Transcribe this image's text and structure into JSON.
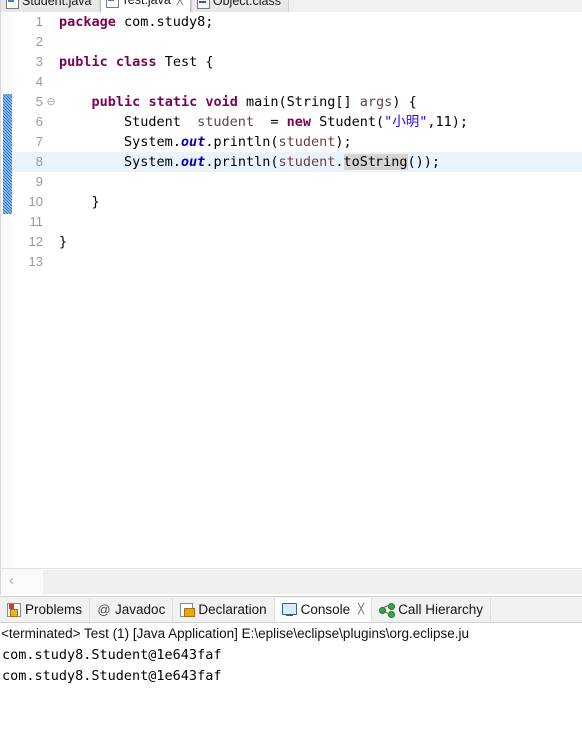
{
  "editor": {
    "tabs": [
      {
        "label": "Student.java",
        "icon": "java-file-icon",
        "active": false,
        "closable": false
      },
      {
        "label": "Test.java",
        "icon": "java-file-icon",
        "active": true,
        "closable": true,
        "close": "╳"
      },
      {
        "label": "Object.class",
        "icon": "class-file-icon",
        "active": false,
        "closable": false
      }
    ],
    "line_numbers": [
      "1",
      "2",
      "3",
      "4",
      "5",
      "6",
      "7",
      "8",
      "9",
      "10",
      "11",
      "12",
      "13"
    ],
    "fold_marker": "⊖",
    "fold_marker_line": 5,
    "current_line": 8,
    "changebar_lines": [
      5,
      6,
      7,
      8,
      9,
      10
    ],
    "code_lines": [
      {
        "n": "1",
        "tokens": [
          {
            "t": "package",
            "c": "kw"
          },
          {
            "t": " com.study8;",
            "c": "plain"
          }
        ]
      },
      {
        "n": "2",
        "tokens": []
      },
      {
        "n": "3",
        "tokens": [
          {
            "t": "public",
            "c": "kw"
          },
          {
            "t": " ",
            "c": "plain"
          },
          {
            "t": "class",
            "c": "kw"
          },
          {
            "t": " Test {",
            "c": "plain"
          }
        ]
      },
      {
        "n": "4",
        "tokens": []
      },
      {
        "n": "5",
        "tokens": [
          {
            "t": "    ",
            "c": "plain"
          },
          {
            "t": "public",
            "c": "kw"
          },
          {
            "t": " ",
            "c": "plain"
          },
          {
            "t": "static",
            "c": "kw"
          },
          {
            "t": " ",
            "c": "plain"
          },
          {
            "t": "void",
            "c": "kw"
          },
          {
            "t": " main(String[] ",
            "c": "plain"
          },
          {
            "t": "args",
            "c": "var"
          },
          {
            "t": ") {",
            "c": "plain"
          }
        ]
      },
      {
        "n": "6",
        "tokens": [
          {
            "t": "        Student  ",
            "c": "plain"
          },
          {
            "t": "student",
            "c": "var"
          },
          {
            "t": "  = ",
            "c": "plain"
          },
          {
            "t": "new",
            "c": "kw"
          },
          {
            "t": " Student(",
            "c": "plain"
          },
          {
            "t": "\"小明\"",
            "c": "str"
          },
          {
            "t": ",11);",
            "c": "plain"
          }
        ]
      },
      {
        "n": "7",
        "tokens": [
          {
            "t": "        System.",
            "c": "plain"
          },
          {
            "t": "out",
            "c": "fld"
          },
          {
            "t": ".println(",
            "c": "plain"
          },
          {
            "t": "student",
            "c": "var"
          },
          {
            "t": ");",
            "c": "plain"
          }
        ]
      },
      {
        "n": "8",
        "tokens": [
          {
            "t": "        System.",
            "c": "plain"
          },
          {
            "t": "out",
            "c": "fld"
          },
          {
            "t": ".println(",
            "c": "plain"
          },
          {
            "t": "student",
            "c": "var"
          },
          {
            "t": ".",
            "c": "plain"
          },
          {
            "t": "toSt",
            "c": "occ"
          },
          {
            "t": "CARET",
            "c": "caret"
          },
          {
            "t": "ring",
            "c": "occ"
          },
          {
            "t": "());",
            "c": "plain"
          }
        ]
      },
      {
        "n": "9",
        "tokens": []
      },
      {
        "n": "10",
        "tokens": [
          {
            "t": "    }",
            "c": "plain"
          }
        ]
      },
      {
        "n": "11",
        "tokens": []
      },
      {
        "n": "12",
        "tokens": [
          {
            "t": "}",
            "c": "plain"
          }
        ]
      },
      {
        "n": "13",
        "tokens": []
      }
    ],
    "scrollbar": {
      "left_arrow": "‹"
    }
  },
  "bottom_panel": {
    "tabs": [
      {
        "label": "Problems",
        "icon": "problems-icon",
        "active": false,
        "closable": false
      },
      {
        "label": "Javadoc",
        "icon": "javadoc-at-icon",
        "active": false,
        "closable": false
      },
      {
        "label": "Declaration",
        "icon": "declaration-icon",
        "active": false,
        "closable": false
      },
      {
        "label": "Console",
        "icon": "console-icon",
        "active": true,
        "closable": true,
        "close": "╳"
      },
      {
        "label": "Call Hierarchy",
        "icon": "call-hierarchy-icon",
        "active": false,
        "closable": false
      }
    ],
    "console": {
      "status_line": "<terminated> Test (1) [Java Application] E:\\eplise\\eclipse\\plugins\\org.eclipse.ju",
      "output_lines": [
        "com.study8.Student@1e643faf",
        "com.study8.Student@1e643faf"
      ]
    }
  },
  "colors": {
    "keyword": "#7f0055",
    "string": "#2a00ff",
    "static_field": "#0000c0",
    "local_variable": "#6a3e3e",
    "current_line_bg": "#eaf2fb",
    "occurrence_bg": "#d4d4d4",
    "changebar": "#2a7fd4",
    "line_number": "#9a9a9a"
  }
}
